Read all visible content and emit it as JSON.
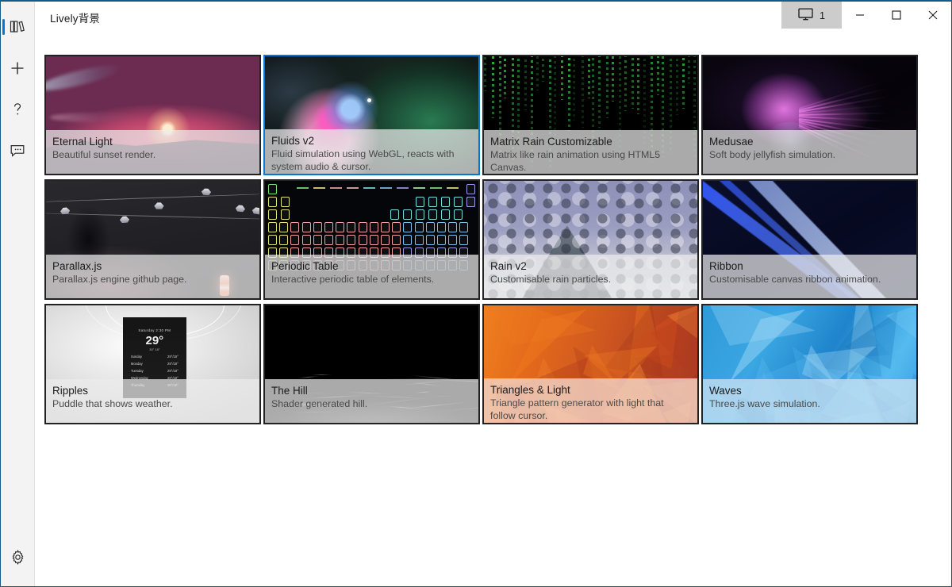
{
  "window": {
    "title": "Lively背景",
    "screen_selector_label": "1",
    "screen_selector_icon": "monitor-icon",
    "minimize_label": "─",
    "maximize_label": "□",
    "close_label": "✕",
    "accent_color": "#0078d7",
    "titlebar_bg": "#ffffff",
    "screen_selector_bg": "#cccccc"
  },
  "sidebar": {
    "background": "#f3f3f3",
    "items": [
      {
        "name": "library",
        "icon": "library-books-icon",
        "selected": true
      },
      {
        "name": "add",
        "icon": "plus-icon",
        "selected": false
      },
      {
        "name": "help",
        "icon": "question-mark-icon",
        "selected": false
      },
      {
        "name": "feedback",
        "icon": "chat-bubble-icon",
        "selected": false
      }
    ],
    "bottom_item": {
      "name": "settings",
      "icon": "gear-icon",
      "selected": false
    }
  },
  "library": {
    "selected_index": 1,
    "wallpapers": [
      {
        "title": "Eternal Light",
        "desc": "Beautiful sunset render."
      },
      {
        "title": "Fluids v2",
        "desc": "Fluid simulation using WebGL, reacts with system audio & cursor."
      },
      {
        "title": "Matrix Rain Customizable",
        "desc": "Matrix like rain animation using HTML5 Canvas."
      },
      {
        "title": "Medusae",
        "desc": "Soft body jellyfish simulation."
      },
      {
        "title": "Parallax.js",
        "desc": "Parallax.js engine github page."
      },
      {
        "title": "Periodic Table",
        "desc": "Interactive periodic table of elements."
      },
      {
        "title": "Rain v2",
        "desc": "Customisable rain particles."
      },
      {
        "title": "Ribbon",
        "desc": "Customisable canvas ribbon animation."
      },
      {
        "title": "Ripples",
        "desc": "Puddle that shows weather."
      },
      {
        "title": "The Hill",
        "desc": "Shader generated hill."
      },
      {
        "title": "Triangles & Light",
        "desc": "Triangle pattern generator with light that follow cursor."
      },
      {
        "title": "Waves",
        "desc": "Three.js wave simulation."
      }
    ]
  },
  "ripples_widget": {
    "location": "Saturday 2:30 PM",
    "temperature": "29°",
    "hilo": "30° 18°",
    "forecast": [
      {
        "day": "Sunday",
        "temp": "29°/18°"
      },
      {
        "day": "Monday",
        "temp": "29°/18°"
      },
      {
        "day": "Tuesday",
        "temp": "29°/18°"
      },
      {
        "day": "Wednesday",
        "temp": "28°/18°"
      },
      {
        "day": "Thursday",
        "temp": "28°/18°"
      }
    ]
  }
}
